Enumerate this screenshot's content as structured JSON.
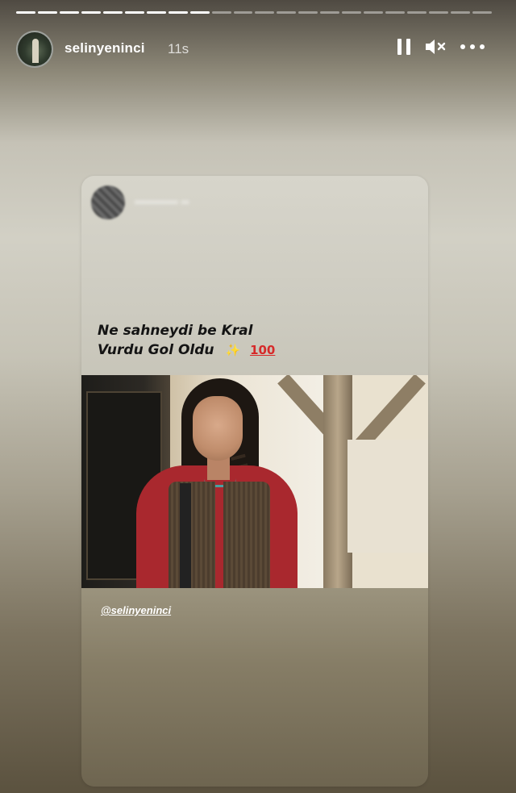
{
  "story": {
    "progress_segments": 22,
    "segments_viewed": 9,
    "username": "selinyeninci",
    "time_ago": "11s"
  },
  "controls": {
    "pause_icon": "pause-icon",
    "mute_icon": "muted-speaker-icon",
    "more_icon": "more-options-icon",
    "icon_color": "#ffffff"
  },
  "shared_post": {
    "caption_line1": "Ne sahneydi be Kral",
    "caption_line2": "Vurdu Gol  Oldu",
    "emoji_sparkle": "✨",
    "emoji_100": "100",
    "mention": "@selinyeninci",
    "caption_color": "#141414"
  }
}
